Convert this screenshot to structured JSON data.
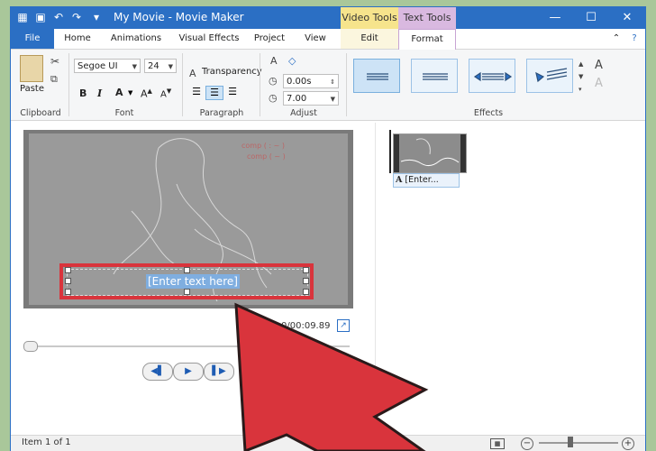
{
  "window": {
    "title": "My Movie - Movie Maker",
    "context_tabs": {
      "video_tools": "Video Tools",
      "text_tools": "Text Tools"
    }
  },
  "ribbon_tabs": {
    "file": "File",
    "home": "Home",
    "animations": "Animations",
    "visual_effects": "Visual Effects",
    "project": "Project",
    "view": "View",
    "edit": "Edit",
    "format": "Format"
  },
  "clipboard": {
    "paste": "Paste",
    "group_label": "Clipboard"
  },
  "font": {
    "family": "Segoe UI",
    "size": "24",
    "group_label": "Font",
    "bold": "B",
    "italic": "I",
    "font_color": "A"
  },
  "paragraph": {
    "transparency": "Transparency",
    "group_label": "Paragraph"
  },
  "adjust": {
    "start_time": "0.00s",
    "duration": "7.00",
    "group_label": "Adjust"
  },
  "effects": {
    "group_label": "Effects"
  },
  "preview": {
    "caption_text": "[Enter text here]",
    "time": "0/00:09.89"
  },
  "storyboard": {
    "caption_label": "[Enter..."
  },
  "status": {
    "item": "Item 1 of 1"
  },
  "colors": {
    "accent": "#2b6fc4",
    "highlight": "#d9343c",
    "video_tools": "#f6e48c",
    "text_tools": "#d9b9e0"
  }
}
